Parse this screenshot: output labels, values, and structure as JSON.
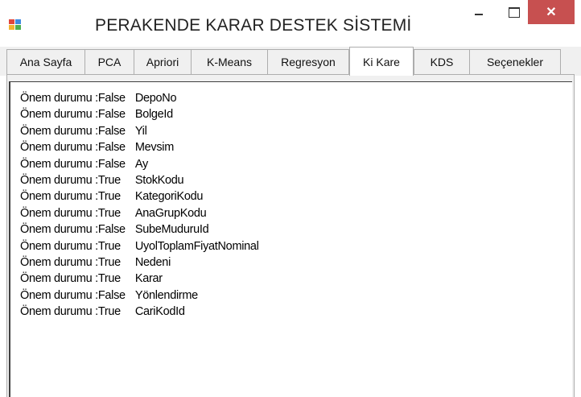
{
  "window": {
    "title": "PERAKENDE KARAR DESTEK SİSTEMİ",
    "close_glyph": "✕",
    "icon_colors": [
      "#e0463c",
      "#3f8ae0",
      "#f0b430",
      "#4caf50"
    ]
  },
  "tabs": [
    {
      "label": "Ana Sayfa"
    },
    {
      "label": "PCA"
    },
    {
      "label": "Apriori"
    },
    {
      "label": "K-Means"
    },
    {
      "label": "Regresyon"
    },
    {
      "label": "Ki Kare"
    },
    {
      "label": "KDS"
    },
    {
      "label": "Seçenekler"
    }
  ],
  "active_tab": "Ki Kare",
  "results": [
    {
      "label": "Önem durumu :",
      "value": "False",
      "variable": "DepoNo"
    },
    {
      "label": "Önem durumu :",
      "value": "False",
      "variable": "BolgeId"
    },
    {
      "label": "Önem durumu :",
      "value": "False",
      "variable": "Yil"
    },
    {
      "label": "Önem durumu :",
      "value": "False",
      "variable": "Mevsim"
    },
    {
      "label": "Önem durumu :",
      "value": "False",
      "variable": "Ay"
    },
    {
      "label": "Önem durumu :",
      "value": "True",
      "variable": "StokKodu"
    },
    {
      "label": "Önem durumu :",
      "value": "True",
      "variable": "KategoriKodu"
    },
    {
      "label": "Önem durumu :",
      "value": "True",
      "variable": "AnaGrupKodu"
    },
    {
      "label": "Önem durumu :",
      "value": "False",
      "variable": "SubeMuduruId"
    },
    {
      "label": "Önem durumu :",
      "value": "True",
      "variable": "UyolToplamFiyatNominal"
    },
    {
      "label": "Önem durumu :",
      "value": "True",
      "variable": "Nedeni"
    },
    {
      "label": "Önem durumu :",
      "value": "True",
      "variable": "Karar"
    },
    {
      "label": "Önem durumu :",
      "value": "False",
      "variable": "Yönlendirme"
    },
    {
      "label": "Önem durumu :",
      "value": "True",
      "variable": "CariKodId"
    }
  ]
}
